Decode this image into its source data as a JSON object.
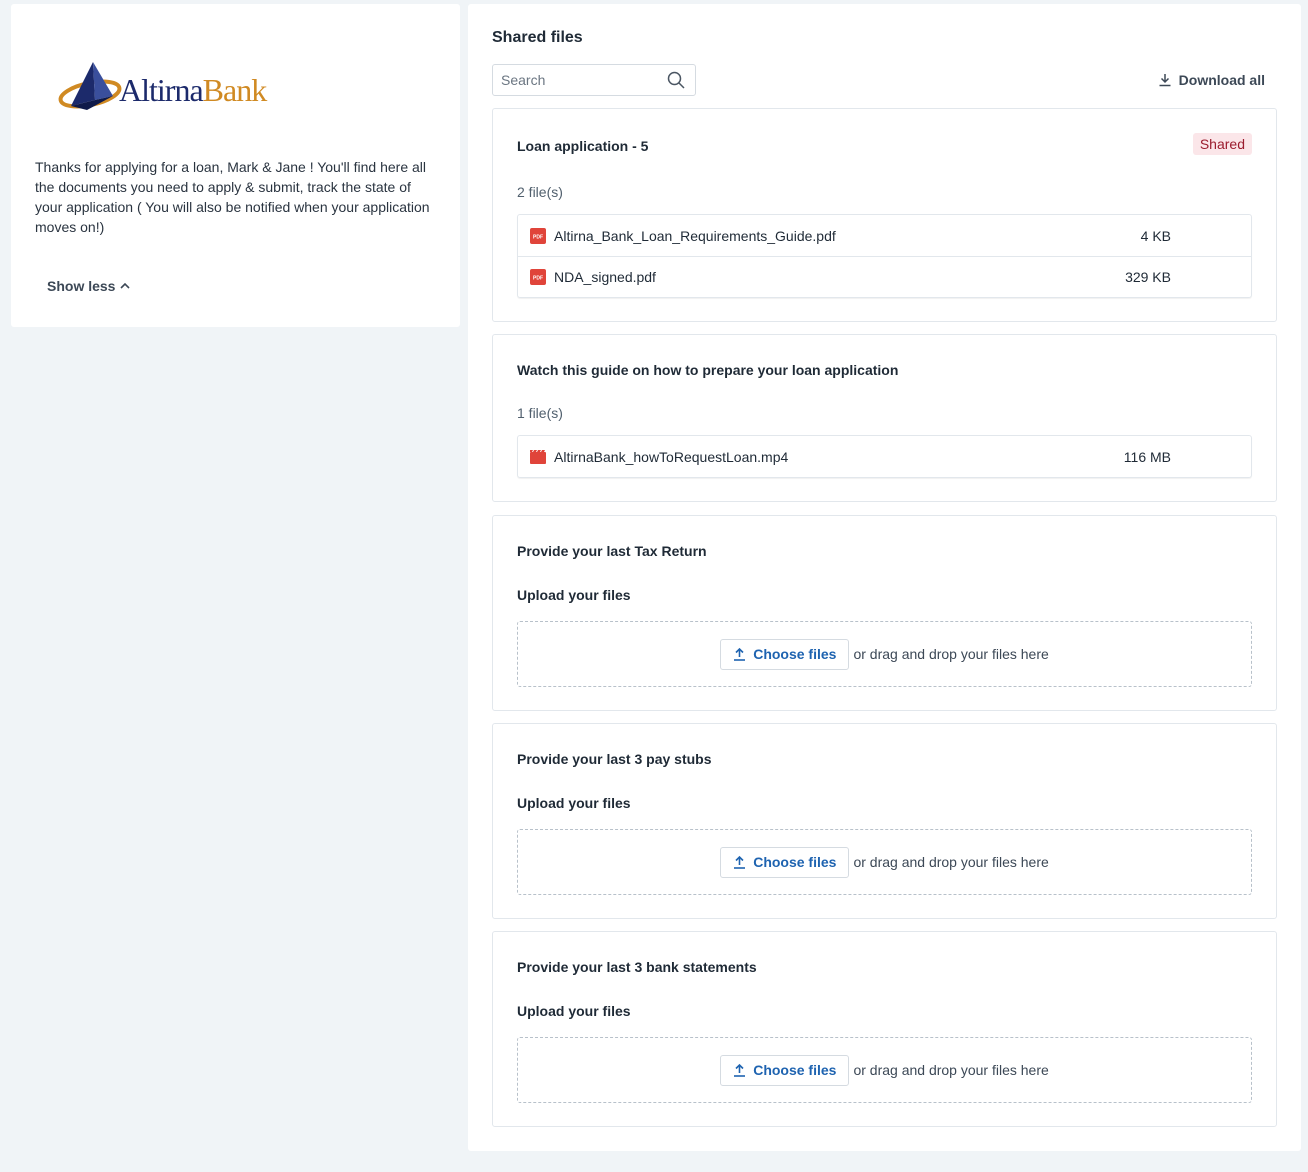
{
  "brand": {
    "name_part1": "Altirna",
    "name_part2": "Bank",
    "color_primary": "#1c2a6b",
    "color_accent": "#d08a23"
  },
  "intro": {
    "message": "Thanks for applying for a loan, Mark & Jane !  You'll find here all the documents you need to apply & submit, track the state of your application ( You will also be notified when your application moves on!)",
    "show_less_label": "Show less"
  },
  "shared_files": {
    "title": "Shared files",
    "search_placeholder": "Search",
    "download_all_label": "Download all"
  },
  "sections": [
    {
      "title": "Loan application - 5",
      "badge": "Shared",
      "file_count": "2 file(s)",
      "files": [
        {
          "name": "Altirna_Bank_Loan_Requirements_Guide.pdf",
          "size": "4 KB",
          "icon": "pdf-icon"
        },
        {
          "name": "NDA_signed.pdf",
          "size": "329 KB",
          "icon": "pdf-icon"
        }
      ]
    },
    {
      "title": "Watch this guide on how to prepare your loan application",
      "file_count": "1 file(s)",
      "files": [
        {
          "name": "AltirnaBank_howToRequestLoan.mp4",
          "size": "116 MB",
          "icon": "video-icon"
        }
      ]
    },
    {
      "title": "Provide your last Tax Return",
      "upload_label": "Upload your files",
      "choose_label": "Choose files",
      "drop_text": "or drag and drop your files here"
    },
    {
      "title": "Provide your last 3 pay stubs",
      "upload_label": "Upload your files",
      "choose_label": "Choose files",
      "drop_text": "or drag and drop your files here"
    },
    {
      "title": "Provide your last 3 bank statements",
      "upload_label": "Upload your files",
      "choose_label": "Choose files",
      "drop_text": "or drag and drop your files here"
    }
  ],
  "colors": {
    "background": "#f0f4f7",
    "link_blue": "#1e63b0",
    "badge_bg": "#fbe6e9",
    "badge_text": "#9b1c2e",
    "file_icon_red": "#e0443a"
  }
}
